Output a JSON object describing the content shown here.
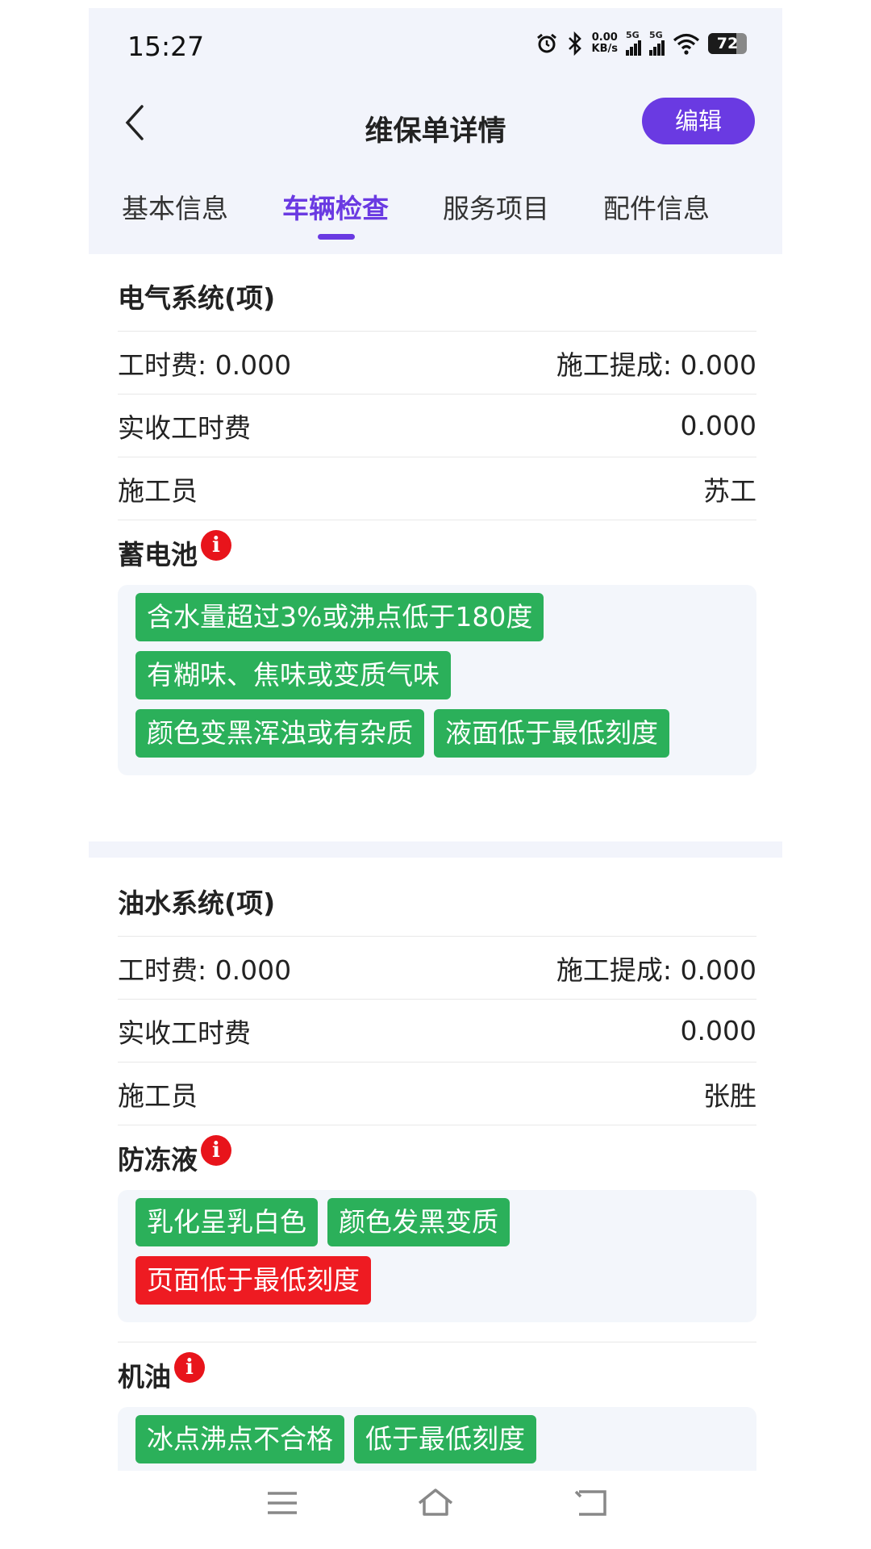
{
  "status_bar": {
    "time": "15:27",
    "net_speed_value": "0.00",
    "net_speed_unit": "KB/s",
    "sim1": "5G",
    "sim2": "5G",
    "battery": "72"
  },
  "header": {
    "title": "维保单详情",
    "edit_label": "编辑"
  },
  "tabs": [
    {
      "label": "基本信息",
      "active": false
    },
    {
      "label": "车辆检查",
      "active": true
    },
    {
      "label": "服务项目",
      "active": false
    },
    {
      "label": "配件信息",
      "active": false
    }
  ],
  "sections": [
    {
      "title": "电气系统(项)",
      "labor_fee_label": "工时费: 0.000",
      "commission_label": "施工提成: 0.000",
      "received_label": "实收工时费",
      "received_value": "0.000",
      "worker_label": "施工员",
      "worker_value": "苏工",
      "items": [
        {
          "name": "蓄电池",
          "info_icon": "info-icon",
          "tags": [
            {
              "text": "含水量超过3%或沸点低于180度",
              "color": "#2bb05a"
            },
            {
              "text": "有糊味、焦味或变质气味",
              "color": "#2bb05a"
            },
            {
              "text": "颜色变黑浑浊或有杂质",
              "color": "#2bb05a"
            },
            {
              "text": "液面低于最低刻度",
              "color": "#2bb05a"
            }
          ]
        }
      ]
    },
    {
      "title": "油水系统(项)",
      "labor_fee_label": "工时费: 0.000",
      "commission_label": "施工提成: 0.000",
      "received_label": "实收工时费",
      "received_value": "0.000",
      "worker_label": "施工员",
      "worker_value": "张胜",
      "items": [
        {
          "name": "防冻液",
          "info_icon": "info-icon",
          "tags": [
            {
              "text": "乳化呈乳白色",
              "color": "#2bb05a"
            },
            {
              "text": "颜色发黑变质",
              "color": "#2bb05a"
            },
            {
              "text": "页面低于最低刻度",
              "color": "#ee1b22"
            }
          ]
        },
        {
          "name": "机油",
          "info_icon": "info-icon",
          "tags": [
            {
              "text": "冰点沸点不合格",
              "color": "#2bb05a"
            },
            {
              "text": "低于最低刻度",
              "color": "#2bb05a"
            }
          ]
        }
      ]
    }
  ],
  "colors": {
    "accent": "#6a3ae2",
    "tag_ok": "#2bb05a",
    "tag_alert": "#ee1b22",
    "info_badge": "#e8141b"
  },
  "navbar": {
    "icons": [
      "menu-icon",
      "home-icon",
      "back-icon"
    ]
  }
}
